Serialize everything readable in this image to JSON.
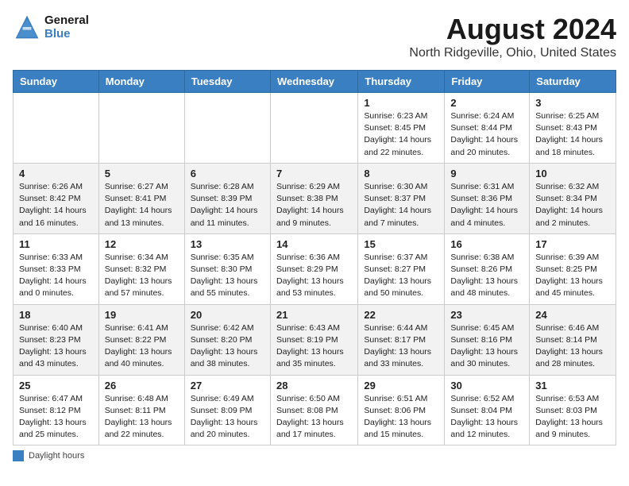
{
  "header": {
    "logo_line1": "General",
    "logo_line2": "Blue",
    "month": "August 2024",
    "location": "North Ridgeville, Ohio, United States"
  },
  "weekdays": [
    "Sunday",
    "Monday",
    "Tuesday",
    "Wednesday",
    "Thursday",
    "Friday",
    "Saturday"
  ],
  "weeks": [
    [
      {
        "day": "",
        "info": ""
      },
      {
        "day": "",
        "info": ""
      },
      {
        "day": "",
        "info": ""
      },
      {
        "day": "",
        "info": ""
      },
      {
        "day": "1",
        "info": "Sunrise: 6:23 AM\nSunset: 8:45 PM\nDaylight: 14 hours\nand 22 minutes."
      },
      {
        "day": "2",
        "info": "Sunrise: 6:24 AM\nSunset: 8:44 PM\nDaylight: 14 hours\nand 20 minutes."
      },
      {
        "day": "3",
        "info": "Sunrise: 6:25 AM\nSunset: 8:43 PM\nDaylight: 14 hours\nand 18 minutes."
      }
    ],
    [
      {
        "day": "4",
        "info": "Sunrise: 6:26 AM\nSunset: 8:42 PM\nDaylight: 14 hours\nand 16 minutes."
      },
      {
        "day": "5",
        "info": "Sunrise: 6:27 AM\nSunset: 8:41 PM\nDaylight: 14 hours\nand 13 minutes."
      },
      {
        "day": "6",
        "info": "Sunrise: 6:28 AM\nSunset: 8:39 PM\nDaylight: 14 hours\nand 11 minutes."
      },
      {
        "day": "7",
        "info": "Sunrise: 6:29 AM\nSunset: 8:38 PM\nDaylight: 14 hours\nand 9 minutes."
      },
      {
        "day": "8",
        "info": "Sunrise: 6:30 AM\nSunset: 8:37 PM\nDaylight: 14 hours\nand 7 minutes."
      },
      {
        "day": "9",
        "info": "Sunrise: 6:31 AM\nSunset: 8:36 PM\nDaylight: 14 hours\nand 4 minutes."
      },
      {
        "day": "10",
        "info": "Sunrise: 6:32 AM\nSunset: 8:34 PM\nDaylight: 14 hours\nand 2 minutes."
      }
    ],
    [
      {
        "day": "11",
        "info": "Sunrise: 6:33 AM\nSunset: 8:33 PM\nDaylight: 14 hours\nand 0 minutes."
      },
      {
        "day": "12",
        "info": "Sunrise: 6:34 AM\nSunset: 8:32 PM\nDaylight: 13 hours\nand 57 minutes."
      },
      {
        "day": "13",
        "info": "Sunrise: 6:35 AM\nSunset: 8:30 PM\nDaylight: 13 hours\nand 55 minutes."
      },
      {
        "day": "14",
        "info": "Sunrise: 6:36 AM\nSunset: 8:29 PM\nDaylight: 13 hours\nand 53 minutes."
      },
      {
        "day": "15",
        "info": "Sunrise: 6:37 AM\nSunset: 8:27 PM\nDaylight: 13 hours\nand 50 minutes."
      },
      {
        "day": "16",
        "info": "Sunrise: 6:38 AM\nSunset: 8:26 PM\nDaylight: 13 hours\nand 48 minutes."
      },
      {
        "day": "17",
        "info": "Sunrise: 6:39 AM\nSunset: 8:25 PM\nDaylight: 13 hours\nand 45 minutes."
      }
    ],
    [
      {
        "day": "18",
        "info": "Sunrise: 6:40 AM\nSunset: 8:23 PM\nDaylight: 13 hours\nand 43 minutes."
      },
      {
        "day": "19",
        "info": "Sunrise: 6:41 AM\nSunset: 8:22 PM\nDaylight: 13 hours\nand 40 minutes."
      },
      {
        "day": "20",
        "info": "Sunrise: 6:42 AM\nSunset: 8:20 PM\nDaylight: 13 hours\nand 38 minutes."
      },
      {
        "day": "21",
        "info": "Sunrise: 6:43 AM\nSunset: 8:19 PM\nDaylight: 13 hours\nand 35 minutes."
      },
      {
        "day": "22",
        "info": "Sunrise: 6:44 AM\nSunset: 8:17 PM\nDaylight: 13 hours\nand 33 minutes."
      },
      {
        "day": "23",
        "info": "Sunrise: 6:45 AM\nSunset: 8:16 PM\nDaylight: 13 hours\nand 30 minutes."
      },
      {
        "day": "24",
        "info": "Sunrise: 6:46 AM\nSunset: 8:14 PM\nDaylight: 13 hours\nand 28 minutes."
      }
    ],
    [
      {
        "day": "25",
        "info": "Sunrise: 6:47 AM\nSunset: 8:12 PM\nDaylight: 13 hours\nand 25 minutes."
      },
      {
        "day": "26",
        "info": "Sunrise: 6:48 AM\nSunset: 8:11 PM\nDaylight: 13 hours\nand 22 minutes."
      },
      {
        "day": "27",
        "info": "Sunrise: 6:49 AM\nSunset: 8:09 PM\nDaylight: 13 hours\nand 20 minutes."
      },
      {
        "day": "28",
        "info": "Sunrise: 6:50 AM\nSunset: 8:08 PM\nDaylight: 13 hours\nand 17 minutes."
      },
      {
        "day": "29",
        "info": "Sunrise: 6:51 AM\nSunset: 8:06 PM\nDaylight: 13 hours\nand 15 minutes."
      },
      {
        "day": "30",
        "info": "Sunrise: 6:52 AM\nSunset: 8:04 PM\nDaylight: 13 hours\nand 12 minutes."
      },
      {
        "day": "31",
        "info": "Sunrise: 6:53 AM\nSunset: 8:03 PM\nDaylight: 13 hours\nand 9 minutes."
      }
    ]
  ],
  "legend": {
    "label": "Daylight hours"
  }
}
